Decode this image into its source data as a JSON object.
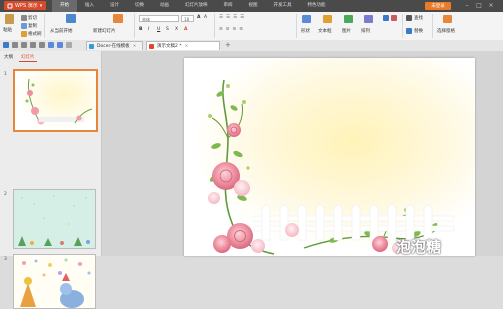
{
  "app": {
    "logo_text": "WPS 演示"
  },
  "menu": {
    "tabs": [
      "开始",
      "插入",
      "设计",
      "切换",
      "动画",
      "幻灯片放映",
      "审阅",
      "视图",
      "开发工具",
      "特色功能"
    ],
    "active_index": 0,
    "login_label": "未登录"
  },
  "ribbon": {
    "paste_label": "粘贴",
    "cut_label": "剪切",
    "copy_label": "复制",
    "format_painter_label": "格式刷",
    "from_current_label": "从当前开始",
    "new_slide_label": "新建幻灯片",
    "font_name": "宋体",
    "font_size": "18",
    "shapes_label": "形状",
    "textbox_label": "文本框",
    "picture_label": "图片",
    "arrange_label": "排列",
    "find_label": "查找",
    "replace_label": "替换",
    "select_pane_label": "选择窗格"
  },
  "doc_tabs": [
    {
      "label": "Docer-在线模板",
      "icon": "docer-icon"
    },
    {
      "label": "演示文稿2 *",
      "icon": "ppt-icon"
    }
  ],
  "left_pane": {
    "tabs": [
      "大纲",
      "幻灯片"
    ],
    "active_tab": 1,
    "slide_numbers": [
      "1",
      "2",
      "3"
    ]
  },
  "watermark": {
    "text": "泡泡糖 ppt.cn"
  },
  "colors": {
    "accent": "#d84a2b",
    "titlebar": "#4a4a4a",
    "ribbon": "#f4f4f4",
    "selection": "#e8873b"
  }
}
